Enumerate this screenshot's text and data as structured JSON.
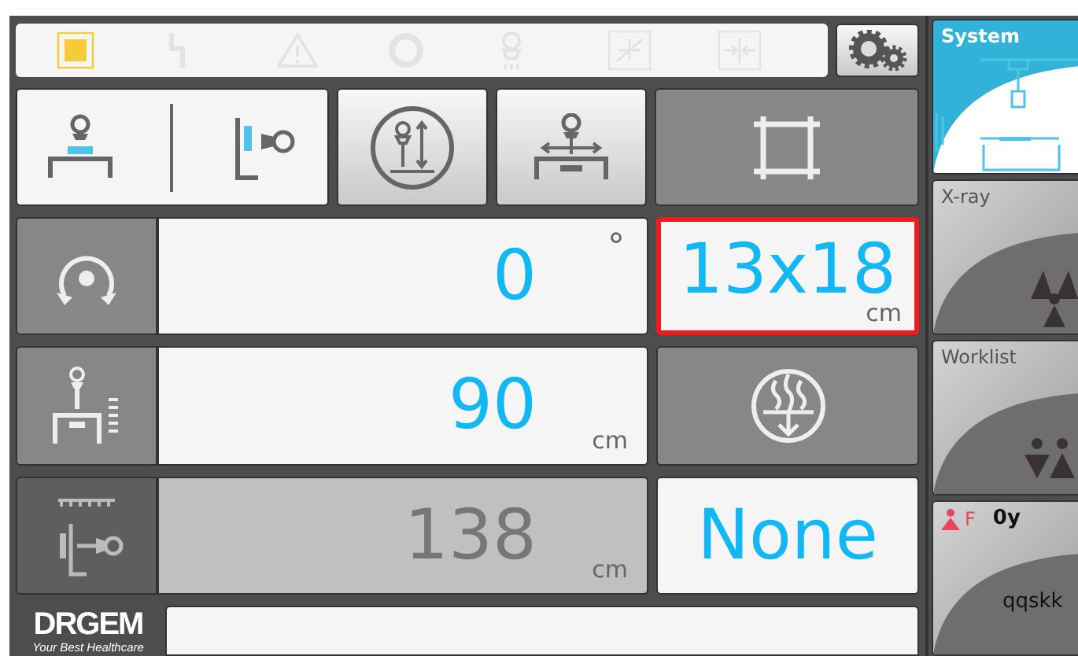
{
  "status_icons": [
    {
      "kind": "standby",
      "active": true
    },
    {
      "kind": "power",
      "active": false
    },
    {
      "kind": "warning",
      "active": false
    },
    {
      "kind": "ring",
      "active": false
    },
    {
      "kind": "tube",
      "active": false
    },
    {
      "kind": "exposure",
      "active": false
    },
    {
      "kind": "compress",
      "active": false
    }
  ],
  "mode_toggle": [
    {
      "kind": "table",
      "selected": true
    },
    {
      "kind": "wall",
      "selected": true
    }
  ],
  "tool_buttons": [
    {
      "kind": "vertical"
    },
    {
      "kind": "horizontal"
    }
  ],
  "readouts": [
    {
      "kind": "rotation",
      "value": "0",
      "unit": "°",
      "disabled": false
    },
    {
      "kind": "height",
      "value": "90",
      "unit": "cm",
      "disabled": false
    },
    {
      "kind": "distance",
      "value": "138",
      "unit": "cm",
      "disabled": true
    }
  ],
  "field_size": {
    "value": "13x18",
    "unit": "cm",
    "highlighted": true
  },
  "grid": {
    "value": "None"
  },
  "logo": {
    "name": "DRGEM",
    "tagline": "Your Best Healthcare"
  },
  "side_tabs": [
    {
      "kind": "system",
      "label": "System",
      "selected": true
    },
    {
      "kind": "xray",
      "label": "X-ray",
      "selected": false
    },
    {
      "kind": "worklist",
      "label": "Worklist",
      "selected": false
    },
    {
      "kind": "patient",
      "sex": "F",
      "age": "0y",
      "name": "qqskk",
      "selected": false
    }
  ]
}
